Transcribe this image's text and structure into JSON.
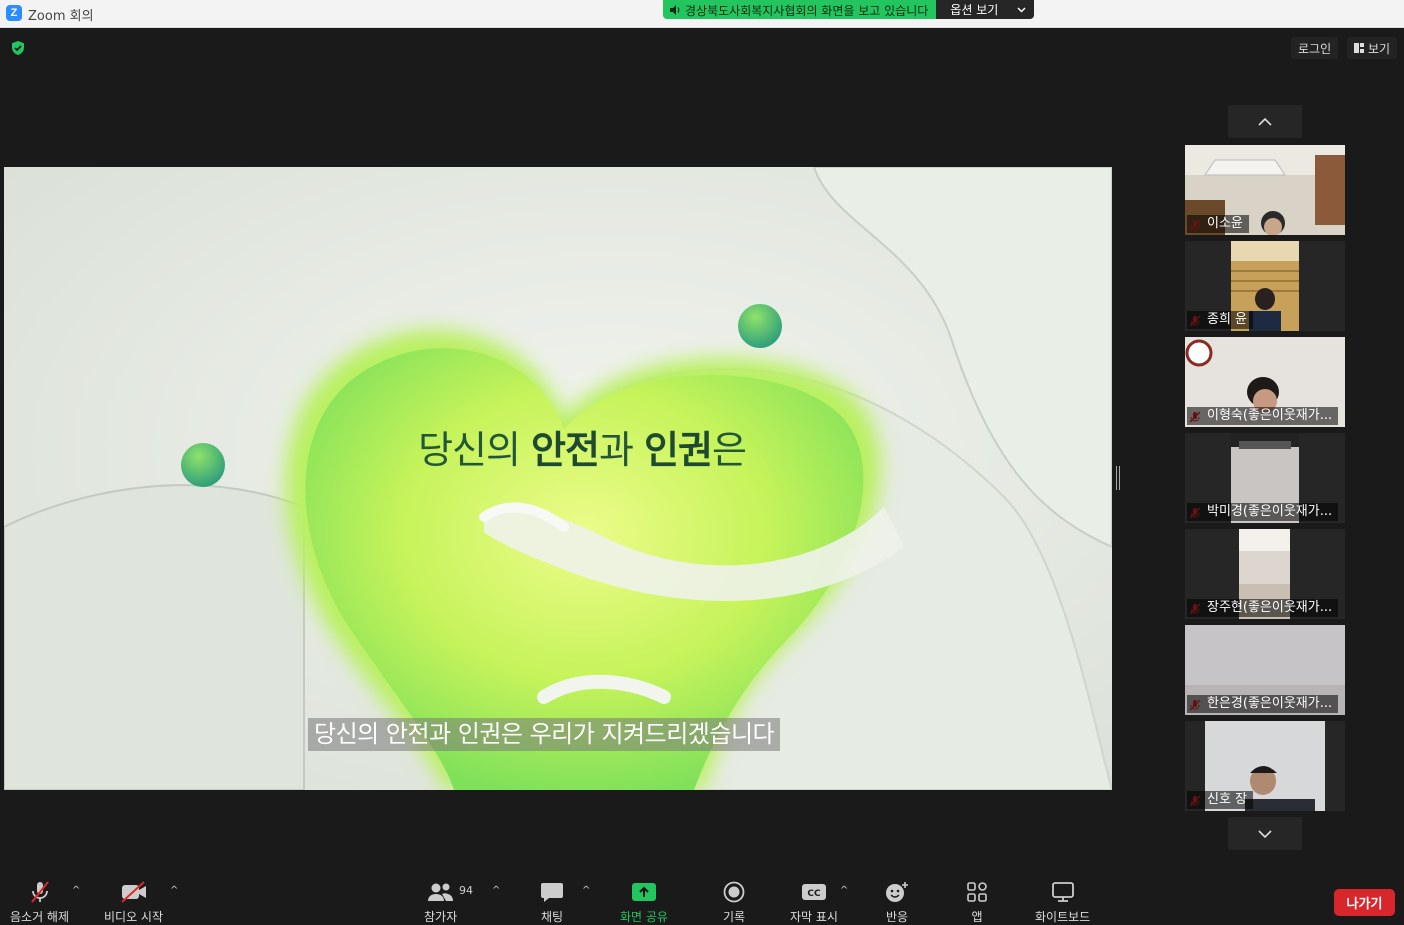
{
  "window": {
    "app_icon": "Z",
    "title": "Zoom 회의"
  },
  "share_banner": {
    "message": "경상북도사회복지사협회의 화면을 보고 있습니다",
    "options_label": "옵션 보기",
    "icon": "speaker-icon"
  },
  "top_right": {
    "login_label": "로그인",
    "view_label": "보기"
  },
  "slide": {
    "heading_pre": "당신의 ",
    "heading_b1": "안전",
    "heading_mid": "과 ",
    "heading_b2": "인권",
    "heading_post": "은",
    "caption": "당신의 안전과 인권은 우리가 지켜드리겠습니다",
    "colors": {
      "bg": "#e3e8e0",
      "heart": "#9fe870",
      "accent": "#3fae6a"
    }
  },
  "participants": [
    {
      "name": "이소윤",
      "muted": true
    },
    {
      "name": "종희 윤",
      "muted": true
    },
    {
      "name": "이형숙(좋은이웃재가...",
      "muted": true
    },
    {
      "name": "박미경(좋은이웃재가...",
      "muted": true
    },
    {
      "name": "장주현(좋은이웃재가...",
      "muted": true
    },
    {
      "name": "한은경(좋은이웃재가...",
      "muted": true
    },
    {
      "name": "신호 장",
      "muted": true
    }
  ],
  "toolbar": {
    "unmute": "음소거 해제",
    "start_video": "비디오 시작",
    "participants": "참가자",
    "participant_count": "94",
    "chat": "채팅",
    "share_screen": "화면 공유",
    "record": "기록",
    "captions": "자막 표시",
    "reactions": "반응",
    "apps": "앱",
    "whiteboard": "화이트보드",
    "leave": "나가기"
  },
  "colors": {
    "share_green": "#23c55e",
    "leave_red": "#d8272c",
    "mute_red": "#e02828"
  }
}
